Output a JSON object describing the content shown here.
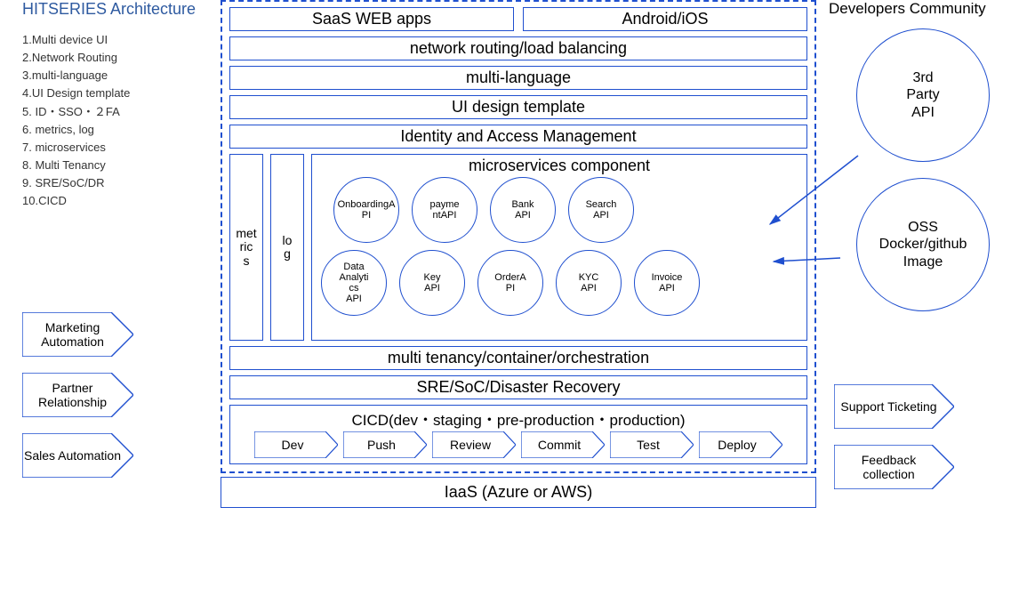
{
  "left": {
    "title": "HITSERIES Architecture",
    "items": [
      "1.Multi device UI",
      "2.Network Routing",
      "3.multi-language",
      "4.UI Design template",
      "5. ID・SSO・２FA",
      "6. metrics, log",
      "7. microservices",
      "8. Multi Tenancy",
      "9. SRE/SoC/DR",
      "10.CICD"
    ],
    "callouts": [
      "Marketing Automation",
      "Partner Relationship",
      "Sales Automation"
    ]
  },
  "center": {
    "top_row": [
      "SaaS WEB apps",
      "Android/iOS"
    ],
    "layers": [
      "network routing/load balancing",
      "multi-language",
      "UI design template",
      "Identity and Access Management"
    ],
    "metrics_label": "met\nric\ns",
    "log_label": "lo\ng",
    "micro_title": "microservices component",
    "apis_row1": [
      "OnboardingA\nPI",
      "payme\nntAPI",
      "Bank\nAPI",
      "Search\nAPI"
    ],
    "apis_row2": [
      "Data\nAnalyti\ncs\nAPI",
      "Key\nAPI",
      "OrderA\nPI",
      "KYC\nAPI",
      "Invoice\nAPI"
    ],
    "lower_layers": [
      "multi tenancy/container/orchestration",
      "SRE/SoC/Disaster Recovery"
    ],
    "cicd_title": "CICD(dev・staging・pre-production・production)",
    "cicd_steps": [
      "Dev",
      "Push",
      "Review",
      "Commit",
      "Test",
      "Deploy"
    ],
    "iaas": "IaaS (Azure or AWS)"
  },
  "right": {
    "title": "Developers Community",
    "circles": [
      "3rd\nParty\nAPI",
      "OSS\nDocker/github\nImage"
    ],
    "callouts": [
      "Support Ticketing",
      "Feedback collection"
    ]
  }
}
